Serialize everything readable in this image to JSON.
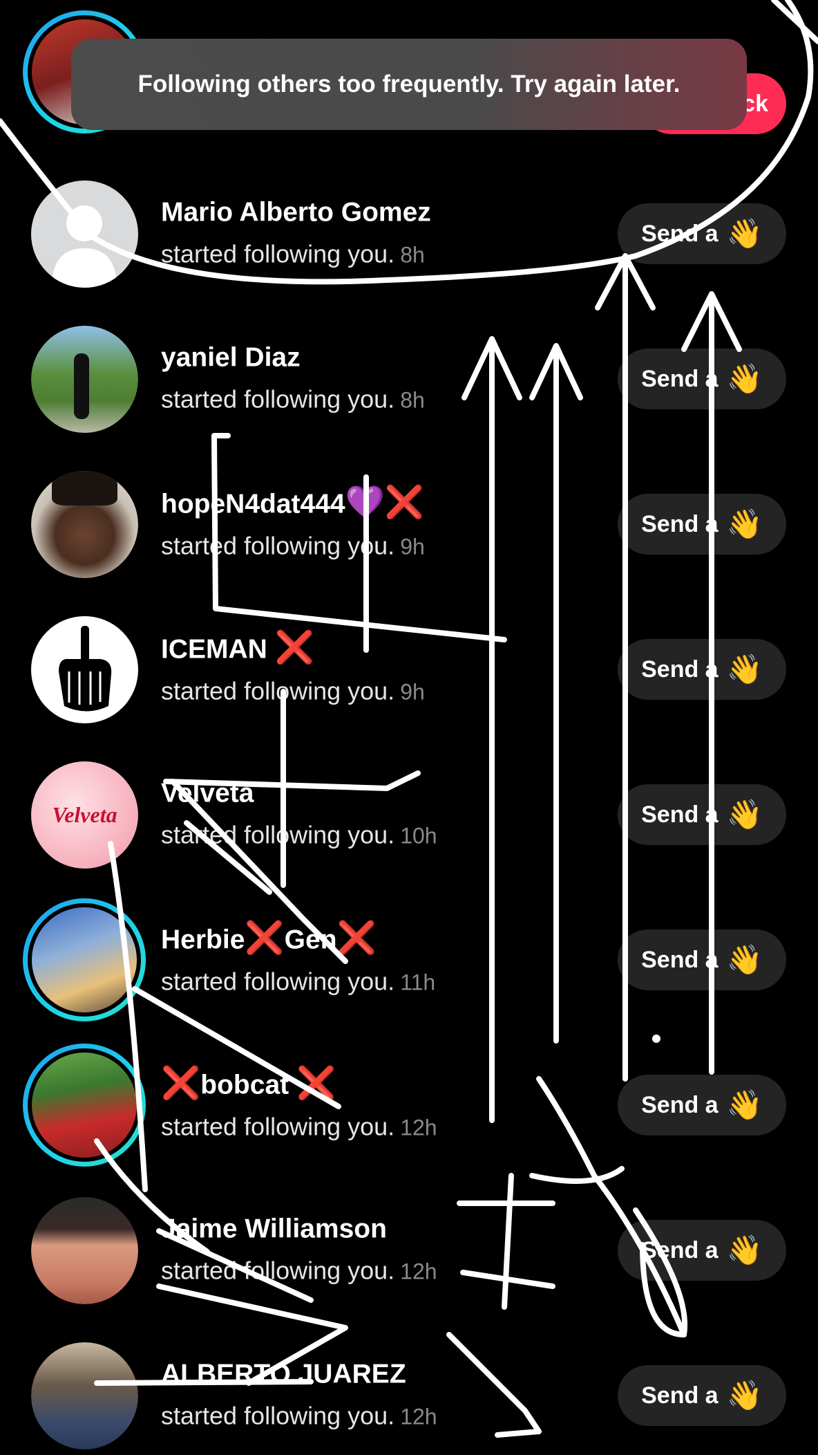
{
  "toast": {
    "message": "Following others too frequently. Try again later."
  },
  "top_button": {
    "label_fragment": "ck"
  },
  "notifications": [
    {
      "name": "Mario Alberto Gomez",
      "action": "started following you.",
      "time": "8h",
      "button": "Send a",
      "avatar": "default-silhouette"
    },
    {
      "name": "yaniel Diaz",
      "action": "started following you.",
      "time": "8h",
      "button": "Send a",
      "avatar": "photo-man-sidewalk"
    },
    {
      "name": "hopeN4dat444",
      "action": "started following you.",
      "time": "9h",
      "button": "Send a",
      "avatar": "photo-woman-selfie"
    },
    {
      "name": "ICEMAN",
      "action": "started following you.",
      "time": "9h",
      "button": "Send a",
      "avatar": "skeleton-hand-logo"
    },
    {
      "name": "Velveta",
      "action": "started following you.",
      "time": "10h",
      "button": "Send a",
      "avatar": "velveta-logo",
      "logo_text": "Velveta"
    },
    {
      "name": "Herbie",
      "name2": "Gen",
      "action": "started following you.",
      "time": "11h",
      "button": "Send a",
      "avatar": "photo-family"
    },
    {
      "name": "bobcat",
      "action": "started following you.",
      "time": "12h",
      "button": "Send a",
      "avatar": "photo-two-men"
    },
    {
      "name": "Jaime Williamson",
      "action": "started following you.",
      "time": "12h",
      "button": "Send a",
      "avatar": "photo-man-cap"
    },
    {
      "name": "ALBERTO JUAREZ",
      "action": "started following you.",
      "time": "12h",
      "button": "Send a",
      "avatar": "photo-man-sitting"
    }
  ],
  "icons": {
    "wave": "👋",
    "x": "❌",
    "heart": "💜"
  }
}
